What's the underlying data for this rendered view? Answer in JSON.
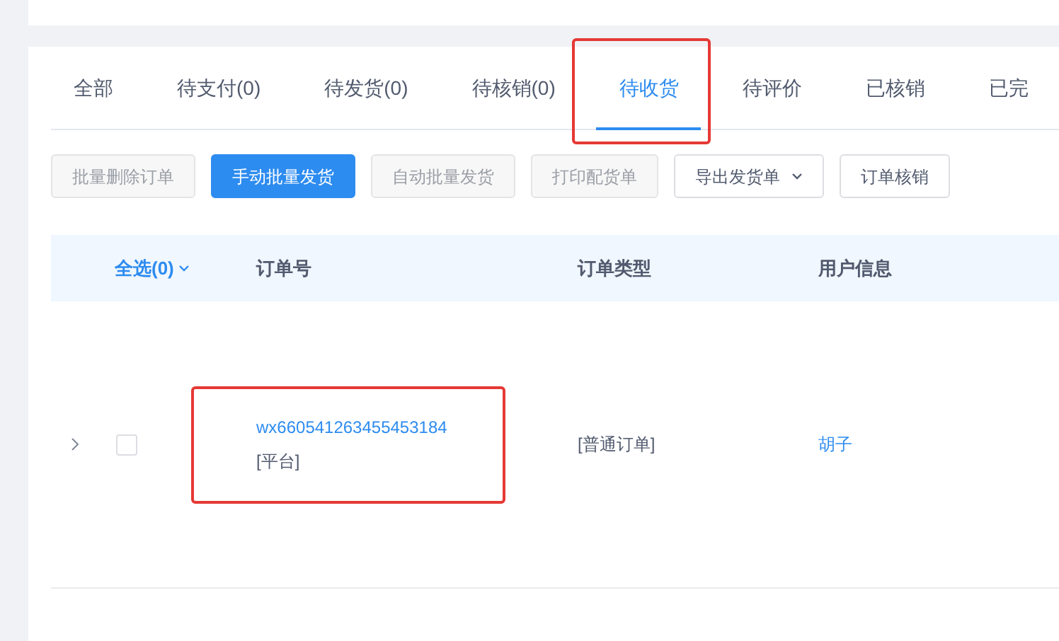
{
  "tabs": [
    {
      "label": "全部",
      "selected": false,
      "highlighted": false
    },
    {
      "label": "待支付(0)",
      "selected": false,
      "highlighted": false
    },
    {
      "label": "待发货(0)",
      "selected": false,
      "highlighted": false
    },
    {
      "label": "待核销(0)",
      "selected": false,
      "highlighted": false
    },
    {
      "label": "待收货",
      "selected": true,
      "highlighted": true
    },
    {
      "label": "待评价",
      "selected": false,
      "highlighted": false
    },
    {
      "label": "已核销",
      "selected": false,
      "highlighted": false
    },
    {
      "label": "已完",
      "selected": false,
      "highlighted": false
    }
  ],
  "buttons": [
    {
      "label": "批量删除订单",
      "kind": "default",
      "disabled": true
    },
    {
      "label": "手动批量发货",
      "kind": "primary",
      "disabled": false
    },
    {
      "label": "自动批量发货",
      "kind": "default",
      "disabled": true
    },
    {
      "label": "打印配货单",
      "kind": "default",
      "disabled": true
    },
    {
      "label": "导出发货单",
      "kind": "dropdown",
      "disabled": false
    },
    {
      "label": "订单核销",
      "kind": "default",
      "disabled": false
    }
  ],
  "table": {
    "select_all": "全选(0)",
    "columns": [
      "订单号",
      "订单类型",
      "用户信息"
    ],
    "rows": [
      {
        "expanded": false,
        "checked": false,
        "order_no": "wx660541263455453184",
        "source": "[平台]",
        "order_type": "[普通订单]",
        "user": "胡子",
        "highlighted": true
      }
    ]
  }
}
